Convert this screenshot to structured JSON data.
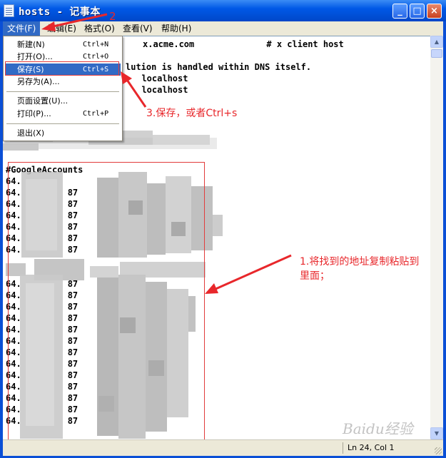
{
  "window": {
    "title": "hosts - 记事本",
    "minimize_label": "_",
    "maximize_label": "□",
    "close_label": "×"
  },
  "menubar": {
    "items": [
      "文件(F)",
      "编辑(E)",
      "格式(O)",
      "查看(V)",
      "帮助(H)"
    ],
    "active_index": 0
  },
  "file_menu": {
    "items": [
      {
        "label": "新建(N)",
        "shortcut": "Ctrl+N"
      },
      {
        "label": "打开(O)...",
        "shortcut": "Ctrl+O"
      },
      {
        "label": "保存(S)",
        "shortcut": "Ctrl+S",
        "highlighted": true
      },
      {
        "label": "另存为(A)...",
        "shortcut": ""
      },
      {
        "label": "页面设置(U)...",
        "shortcut": ""
      },
      {
        "label": "打印(P)...",
        "shortcut": "Ctrl+P"
      },
      {
        "label": "退出(X)",
        "shortcut": ""
      }
    ]
  },
  "editor": {
    "lines_top": [
      "x.acme.com              # x client host",
      "lution is handled within DNS itself.",
      "  localhost",
      "  localhost"
    ],
    "google_header": "#GoogleAccounts",
    "group1_prefix": "64.",
    "group1_lines": [
      "64.",
      "64.         87",
      "64.         87",
      "64.         87",
      "64.         87",
      "64.         87",
      "64.         87"
    ],
    "group2_lines": [
      "64.         87",
      "64.         87",
      "64.         87",
      "64.         87",
      "64.         87",
      "64.         87",
      "64.         87",
      "64.         87",
      "64.         87",
      "64.         87",
      "64.         87",
      "64.         87",
      "64.         87"
    ]
  },
  "statusbar": {
    "position": "Ln 24, Col 1"
  },
  "annotations": {
    "step1": "1.将找到的地址复制粘贴到",
    "step1_line2": "里面；",
    "step2": "2",
    "step3": "3.保存，或者Ctrl+s",
    "color": "#e8272b"
  },
  "watermark": "Baidu经验"
}
